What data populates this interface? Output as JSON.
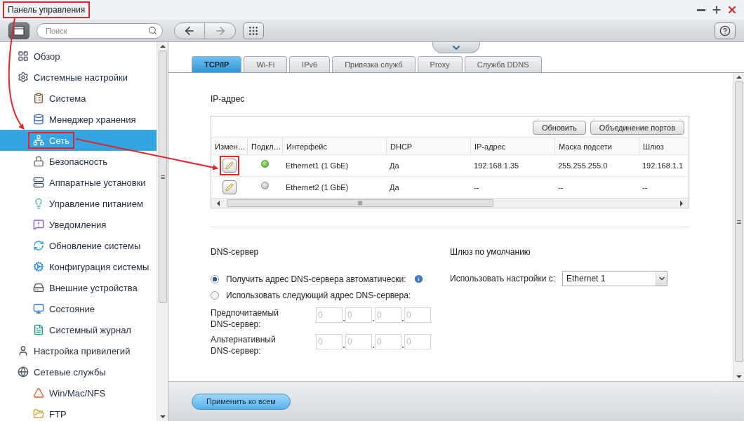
{
  "window": {
    "title": "Панель управления",
    "title_highlighted": true
  },
  "toolbar": {
    "search": {
      "placeholder": "Поиск"
    }
  },
  "sidebar": {
    "items": [
      {
        "label": "Обзор",
        "selected": false,
        "highlighted": false
      },
      {
        "label": "Системные настройки",
        "selected": false,
        "highlighted": false,
        "children": [
          {
            "label": "Система",
            "selected": false,
            "highlighted": false
          },
          {
            "label": "Менеджер хранения",
            "selected": false,
            "highlighted": false
          },
          {
            "label": "Сеть",
            "selected": true,
            "highlighted": true
          },
          {
            "label": "Безопасность",
            "selected": false,
            "highlighted": false
          },
          {
            "label": "Аппаратные установки",
            "selected": false,
            "highlighted": false
          },
          {
            "label": "Управление питанием",
            "selected": false,
            "highlighted": false
          },
          {
            "label": "Уведомления",
            "selected": false,
            "highlighted": false
          },
          {
            "label": "Обновление системы",
            "selected": false,
            "highlighted": false
          },
          {
            "label": "Конфигурация системы",
            "selected": false,
            "highlighted": false
          },
          {
            "label": "Внешние устройства",
            "selected": false,
            "highlighted": false
          },
          {
            "label": "Состояние",
            "selected": false,
            "highlighted": false
          },
          {
            "label": "Системный журнал",
            "selected": false,
            "highlighted": false
          }
        ]
      },
      {
        "label": "Настройка привилегий",
        "selected": false,
        "highlighted": false
      },
      {
        "label": "Сетевые службы",
        "selected": false,
        "highlighted": false,
        "children": [
          {
            "label": "Win/Mac/NFS",
            "selected": false,
            "highlighted": false
          },
          {
            "label": "FTP",
            "selected": false,
            "highlighted": false
          }
        ]
      }
    ]
  },
  "tabs": [
    {
      "label": "TCP/IP",
      "selected": true
    },
    {
      "label": "Wi-Fi",
      "selected": false
    },
    {
      "label": "IPv6",
      "selected": false
    },
    {
      "label": "Привязка служб",
      "selected": false
    },
    {
      "label": "Proxy",
      "selected": false
    },
    {
      "label": "Служба DDNS",
      "selected": false
    }
  ],
  "ip_section": {
    "title": "IP-адрес",
    "buttons": [
      "Обновить",
      "Объединение портов"
    ],
    "table": {
      "columns": [
        "Измен…",
        "Подкл…",
        "Интерфейс",
        "DHCP",
        "IP-адрес",
        "Маска подсети",
        "Шлюз"
      ],
      "rows": [
        {
          "edit_highlighted": true,
          "connected": true,
          "cells": [
            "",
            "",
            "Ethernet1 (1 GbE)",
            "Да",
            "192.168.1.35",
            "255.255.255.0",
            "192.168.1.1"
          ]
        },
        {
          "edit_highlighted": false,
          "connected": false,
          "cells": [
            "",
            "",
            "Ethernet2 (1 GbE)",
            "Да",
            "--",
            "--",
            "--"
          ]
        }
      ]
    }
  },
  "dns": {
    "title": "DNS-сервер",
    "options": [
      {
        "label": "Получить адрес DNS-сервера автоматически:",
        "selected": true
      },
      {
        "label": "Использовать следующий адрес DNS-сервера:",
        "selected": false
      }
    ],
    "servers": [
      {
        "label": "Предпочитаемый DNS-сервер:",
        "disabled": true,
        "octets": [
          "0",
          "0",
          "0",
          "0"
        ]
      },
      {
        "label": "Альтернативный DNS-сервер:",
        "disabled": true,
        "octets": [
          "0",
          "0",
          "0",
          "0"
        ]
      }
    ]
  },
  "gateway": {
    "title": "Шлюз по умолчанию",
    "label": "Использовать настройки с:",
    "value": "Ethernet 1"
  },
  "footer": {
    "apply_button": "Применить ко всем"
  }
}
